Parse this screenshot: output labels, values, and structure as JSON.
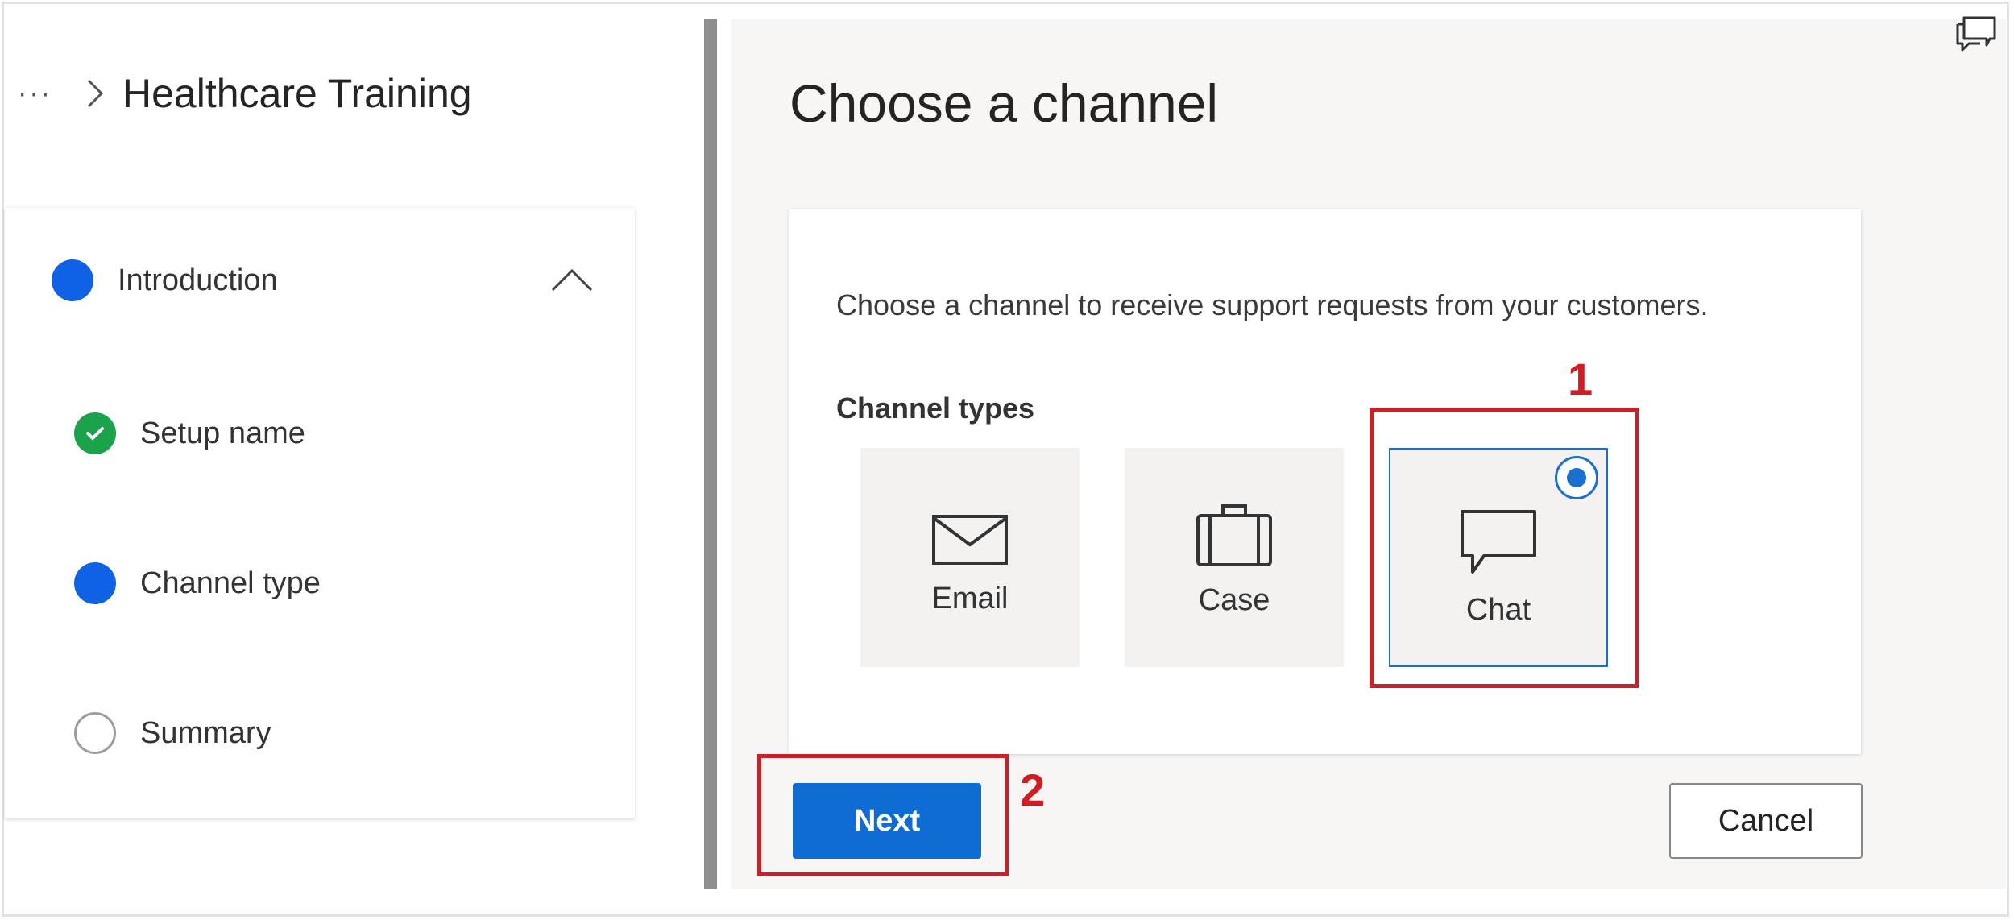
{
  "breadcrumb": {
    "more": "···",
    "title": "Healthcare Training"
  },
  "steps": [
    {
      "label": "Introduction",
      "state": "current-group"
    },
    {
      "label": "Setup name",
      "state": "completed"
    },
    {
      "label": "Channel type",
      "state": "current"
    },
    {
      "label": "Summary",
      "state": "pending"
    }
  ],
  "panel": {
    "title": "Choose a channel",
    "description": "Choose a channel to receive support requests from your customers.",
    "channel_types_label": "Channel types",
    "channels": [
      {
        "label": "Email",
        "icon": "envelope-icon",
        "selected": false
      },
      {
        "label": "Case",
        "icon": "briefcase-icon",
        "selected": false
      },
      {
        "label": "Chat",
        "icon": "chat-bubble-icon",
        "selected": true
      }
    ],
    "next_label": "Next",
    "cancel_label": "Cancel"
  },
  "annotations": {
    "first": "1",
    "second": "2"
  },
  "colors": {
    "accent": "#0f6cd4",
    "annotation": "#c6222a",
    "completed": "#1aa34a",
    "step": "#0f62e6"
  }
}
